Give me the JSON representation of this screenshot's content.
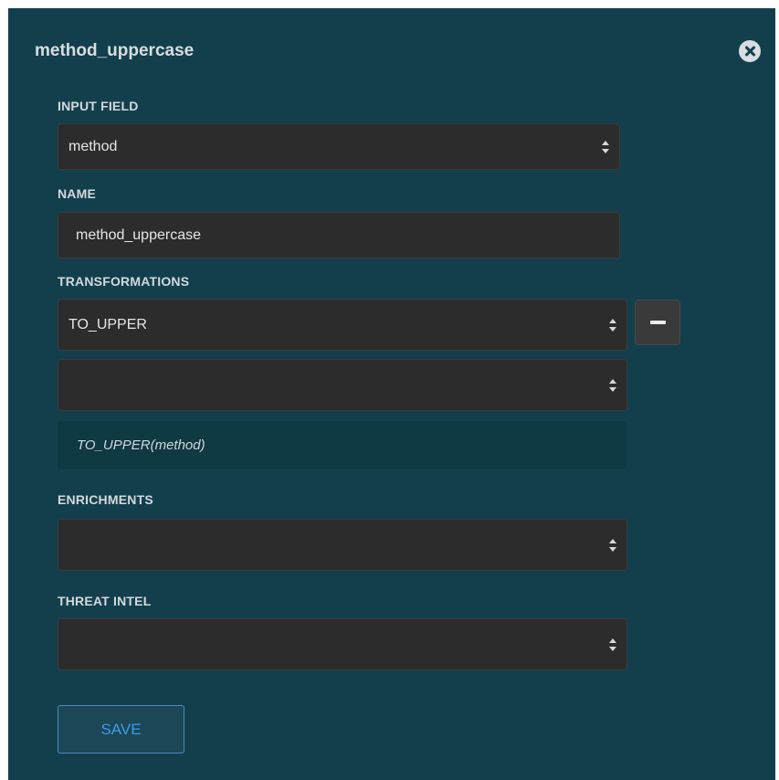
{
  "panel": {
    "title": "method_uppercase",
    "close_icon": "close-circle-icon"
  },
  "form": {
    "input_field": {
      "label": "INPUT FIELD",
      "value": "method"
    },
    "name": {
      "label": "NAME",
      "value": "method_uppercase"
    },
    "transformations": {
      "label": "TRANSFORMATIONS",
      "items": [
        {
          "value": "TO_UPPER"
        },
        {
          "value": ""
        }
      ],
      "remove_icon": "minus-icon",
      "preview": "TO_UPPER(method)"
    },
    "enrichments": {
      "label": "ENRICHMENTS",
      "value": ""
    },
    "threat_intel": {
      "label": "THREAT INTEL",
      "value": ""
    },
    "save_label": "SAVE"
  },
  "colors": {
    "panel_background": "#133f4d",
    "control_background": "#2c2c2c",
    "save_accent": "#3c9ce8"
  }
}
